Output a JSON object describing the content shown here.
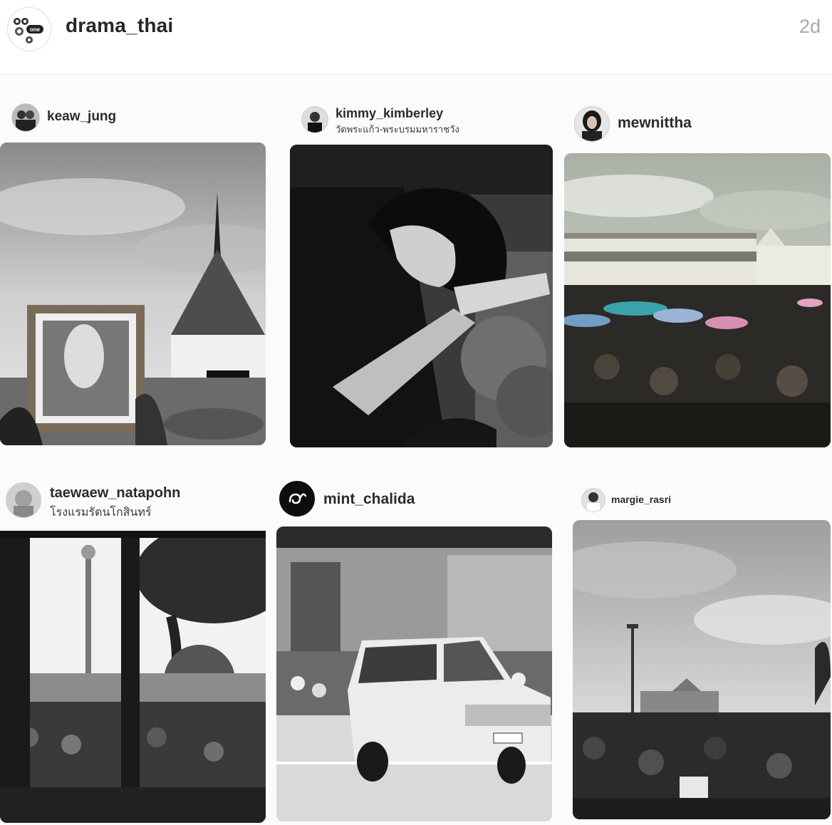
{
  "post": {
    "account": "drama_thai",
    "time": "2d",
    "avatar_icon": "one-channel-logo-icon"
  },
  "collage": {
    "items": [
      {
        "username": "keaw_jung",
        "location": "",
        "avatar_icon": "user-avatar-icon",
        "photo": "grand-palace-portrait-photo"
      },
      {
        "username": "kimmy_kimberley",
        "location": "วัดพระแก้ว-พระบรมมหาราชวัง",
        "avatar_icon": "user-avatar-icon",
        "photo": "woman-praying-photo"
      },
      {
        "username": "mewnittha",
        "location": "",
        "avatar_icon": "user-avatar-icon",
        "photo": "palace-crowd-umbrellas-photo"
      },
      {
        "username": "taewaew_natapohn",
        "location": "โรงแรมรัตนโกสินทร์",
        "avatar_icon": "user-avatar-icon",
        "photo": "window-crowd-photo"
      },
      {
        "username": "mint_chalida",
        "location": "",
        "avatar_icon": "thai-numeral-nine-icon",
        "photo": "royal-van-photo"
      },
      {
        "username": "margie_rasri",
        "location": "",
        "avatar_icon": "user-avatar-icon",
        "photo": "crowd-sky-photo"
      }
    ]
  },
  "colors": {
    "text": "#262626",
    "muted": "#a8a8a8",
    "divider": "#ececec"
  }
}
